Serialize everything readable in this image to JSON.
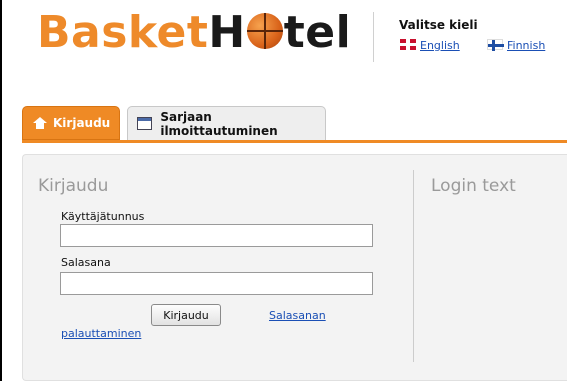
{
  "header": {
    "logo": {
      "part1": "Basket",
      "part2_start": "H",
      "part2_end": "tel"
    },
    "language": {
      "title": "Valitse kieli",
      "options": [
        {
          "label": "English",
          "flag": "uk-flag-icon"
        },
        {
          "label": "Finnish",
          "flag": "finland-flag-icon"
        }
      ]
    }
  },
  "tabs": [
    {
      "label": "Kirjaudu",
      "icon": "home-icon",
      "active": true
    },
    {
      "label": "Sarjaan ilmoittautuminen",
      "icon": "calendar-icon",
      "active": false
    }
  ],
  "login": {
    "heading": "Kirjaudu",
    "username_label": "Käyttäjätunnus",
    "username_value": "",
    "password_label": "Salasana",
    "password_value": "",
    "submit_label": "Kirjaudu",
    "reset_link_line1": "Salasanan",
    "reset_link_line2": "palauttaminen"
  },
  "side": {
    "heading": "Login text"
  },
  "colors": {
    "brand_orange": "#ef8a25",
    "link_blue": "#1a4fb5",
    "heading_gray": "#9a9a9a"
  }
}
